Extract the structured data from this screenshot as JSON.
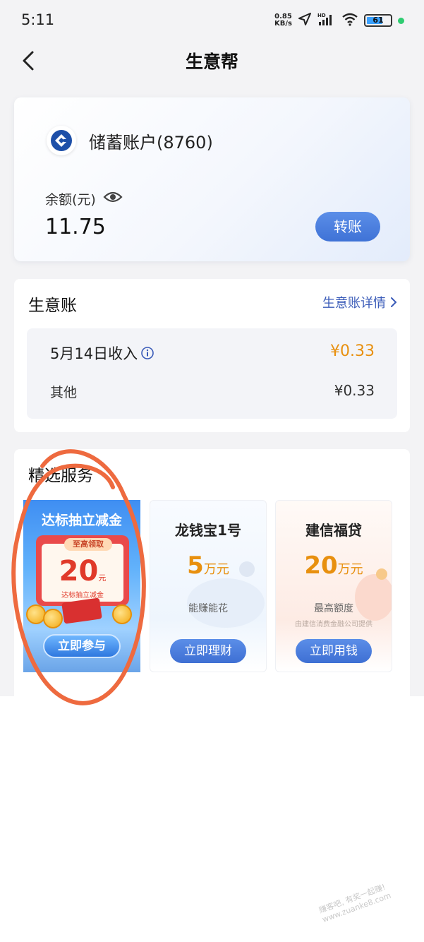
{
  "status_bar": {
    "time": "5:11",
    "speed_top": "0.85",
    "speed_bottom": "KB/s",
    "battery": "61"
  },
  "nav": {
    "title": "生意帮"
  },
  "account": {
    "name": "储蓄账户(8760)",
    "balance_label": "余额(元)",
    "balance": "11.75",
    "transfer_label": "转账"
  },
  "ledger": {
    "title": "生意账",
    "detail_link": "生意账详情",
    "income_label": "5月14日收入",
    "income_value": "¥0.33",
    "other_label": "其他",
    "other_value": "¥0.33"
  },
  "services": {
    "title": "精选服务",
    "promo": {
      "title": "达标抽立减金",
      "tag": "至高领取",
      "amount": "20",
      "unit": "元",
      "subtitle": "达标抽立减金",
      "button": "立即参与"
    },
    "items": [
      {
        "name": "龙钱宝1号",
        "value": "5",
        "unit": "万元",
        "desc": "能赚能花",
        "note": "",
        "button": "立即理财"
      },
      {
        "name": "建信福贷",
        "value": "20",
        "unit": "万元",
        "desc": "最高额度",
        "note": "由建信消费金融公司提供",
        "button": "立即用钱"
      }
    ]
  },
  "watermark": "赚客吧, 有奖一起赚! www.zuanke8.com",
  "colors": {
    "accent_blue": "#3f72d6",
    "amount_orange": "#e8900f",
    "annotation": "#ee6a3f"
  }
}
